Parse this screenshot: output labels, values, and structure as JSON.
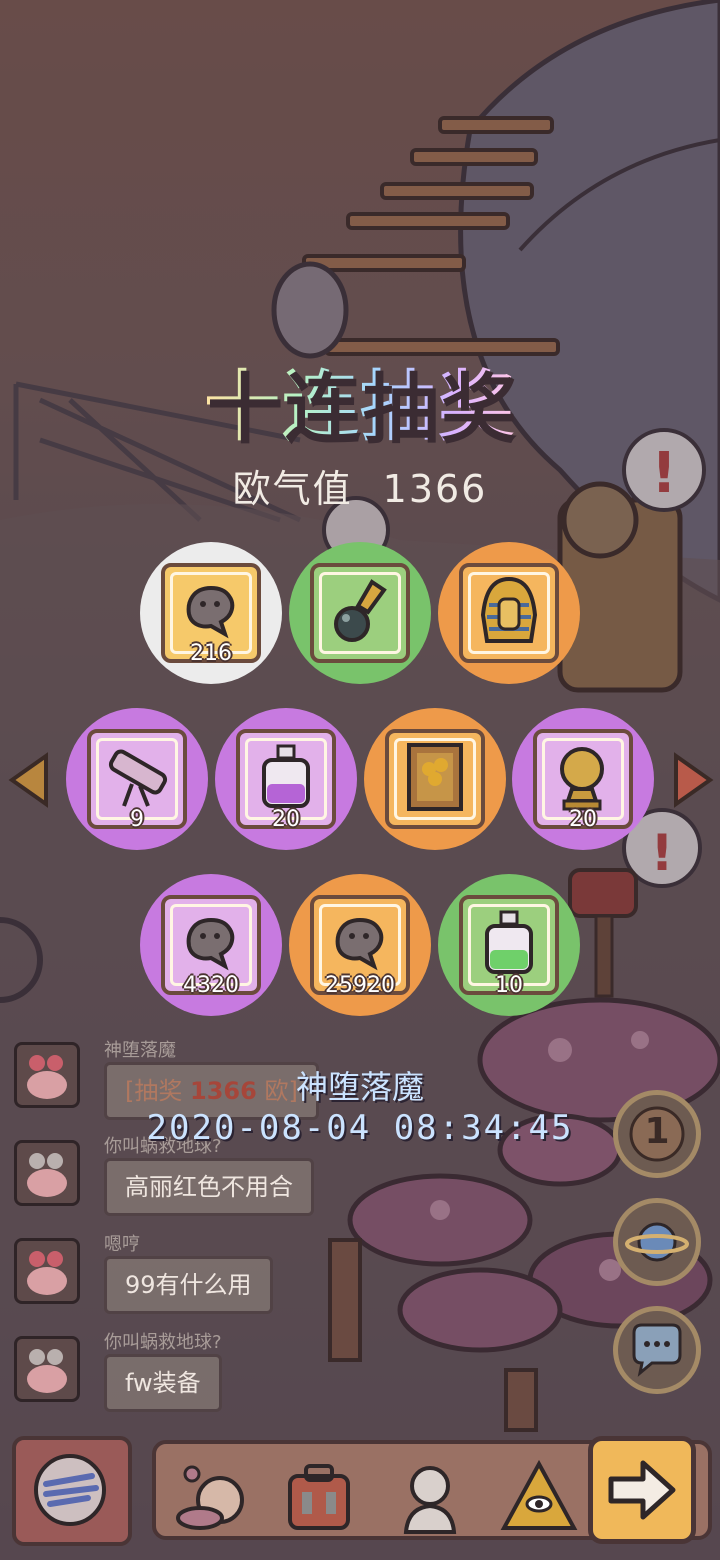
{
  "title": "十连抽奖",
  "luck": {
    "label": "欧气值",
    "value": "1366"
  },
  "rewards": [
    {
      "rarity": "white",
      "item": "snail-blob-icon",
      "qty": "216"
    },
    {
      "rarity": "green",
      "item": "pendant-icon",
      "qty": ""
    },
    {
      "rarity": "orange",
      "item": "pharaoh-mask-icon",
      "qty": ""
    },
    {
      "rarity": "purple",
      "item": "telescope-icon",
      "qty": "9"
    },
    {
      "rarity": "purple",
      "item": "purple-potion-icon",
      "qty": "20"
    },
    {
      "rarity": "orange",
      "item": "sunflower-painting-icon",
      "qty": ""
    },
    {
      "rarity": "purple",
      "item": "golden-statue-icon",
      "qty": "20"
    },
    {
      "rarity": "purple",
      "item": "snail-blob-icon",
      "qty": "4320"
    },
    {
      "rarity": "orange",
      "item": "snail-blob-icon",
      "qty": "25920"
    },
    {
      "rarity": "green",
      "item": "green-potion-icon",
      "qty": "10"
    }
  ],
  "chat": [
    {
      "name": "神堕落魔",
      "prefix": "[抽奖",
      "value": "1366",
      "suffix": "欧]"
    },
    {
      "name": "你叫蜗救地球?",
      "text": "高丽红色不用合"
    },
    {
      "name": "嗯哼",
      "text": "99有什么用"
    },
    {
      "name": "你叫蜗救地球?",
      "text": "fw装备"
    }
  ],
  "winner": {
    "name": "神堕落魔",
    "datetime": "2020-08-04  08:34:45"
  },
  "side_buttons": {
    "badge_number": "1"
  },
  "colors": {
    "white": "#ececec",
    "green": "#79c36b",
    "orange": "#ee9a4a",
    "purple": "#c77ae0",
    "highlight": "#a6463a"
  }
}
